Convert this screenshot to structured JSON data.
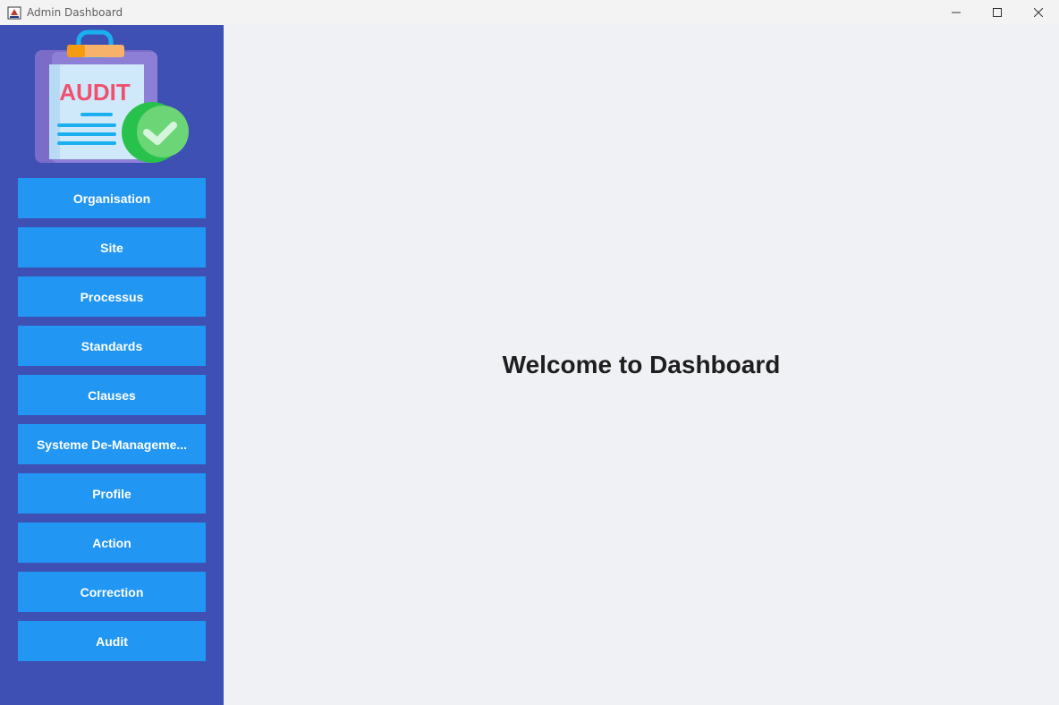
{
  "window": {
    "title": "Admin Dashboard",
    "controls": [
      "minimize-icon",
      "maximize-icon",
      "close-icon"
    ]
  },
  "logo": {
    "text": "AUDIT",
    "colors": {
      "board": "#7b6cc8",
      "paper": "#cfe9fb",
      "text": "#f0506e",
      "clip": "#f6b26b",
      "check": "#27c14b"
    }
  },
  "sidebar": {
    "background": "#3e50b4",
    "button_color": "#2196f3",
    "items": [
      {
        "label": "Organisation"
      },
      {
        "label": "Site"
      },
      {
        "label": "Processus"
      },
      {
        "label": "Standards"
      },
      {
        "label": "Clauses"
      },
      {
        "label": "Systeme De-Manageme..."
      },
      {
        "label": "Profile"
      },
      {
        "label": "Action"
      },
      {
        "label": "Correction"
      },
      {
        "label": "Audit"
      }
    ]
  },
  "main": {
    "welcome": "Welcome to Dashboard"
  }
}
